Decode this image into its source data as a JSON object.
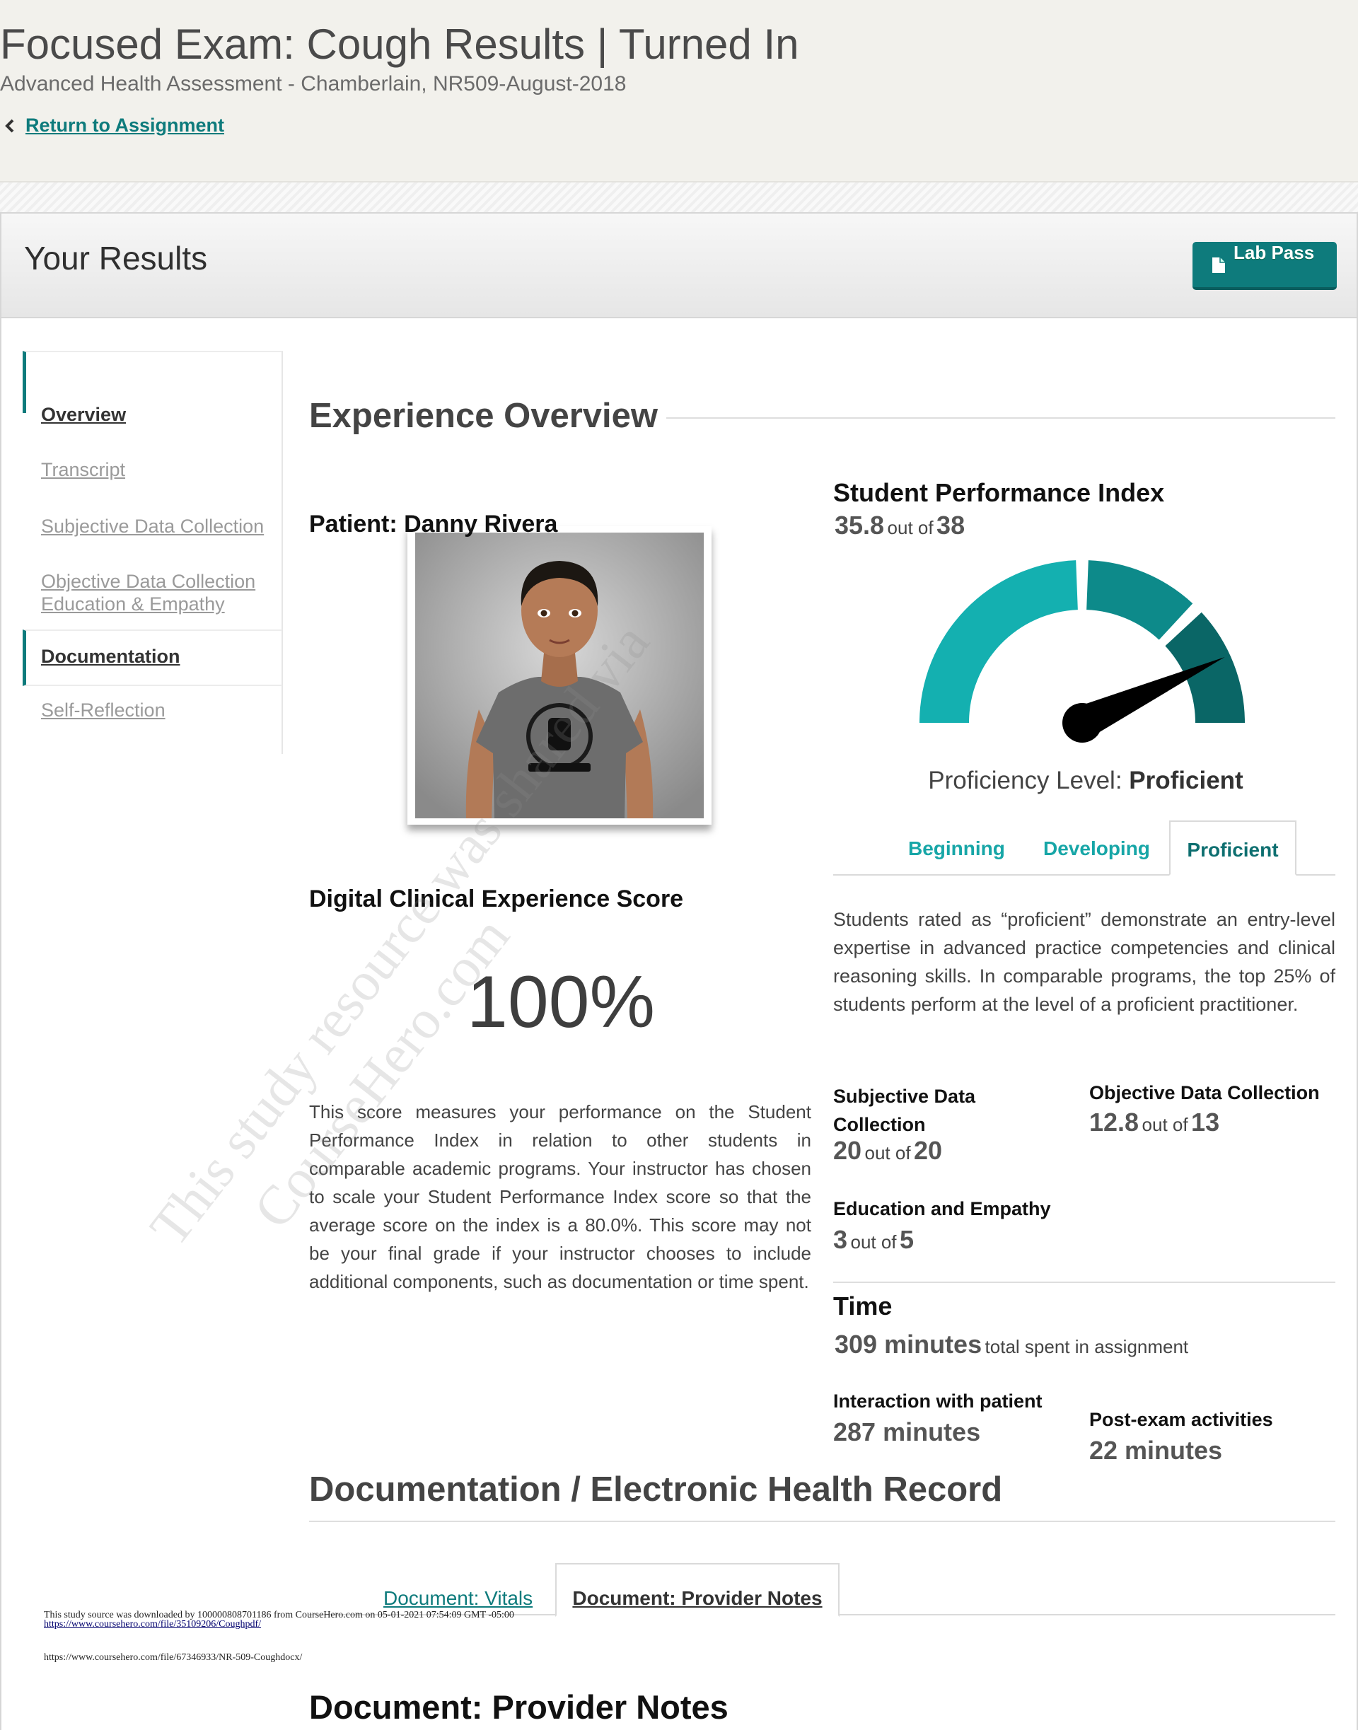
{
  "header": {
    "title": "Focused Exam: Cough Results | Turned In",
    "subtitle": "Advanced Health Assessment - Chamberlain, NR509-August-2018",
    "return_link": "Return to Assignment"
  },
  "panel": {
    "title": "Your Results",
    "lab_pass_label": "Lab Pass"
  },
  "sidebar": {
    "items": [
      {
        "label": "Overview"
      },
      {
        "label": "Transcript"
      },
      {
        "label": "Subjective Data Collection"
      },
      {
        "label": "Objective Data Collection"
      },
      {
        "label": "Education & Empathy"
      },
      {
        "label": "Documentation"
      },
      {
        "label": "Self-Reflection"
      }
    ]
  },
  "overview": {
    "section_title": "Experience Overview",
    "patient_label": "Patient: Danny Rivera",
    "dce_title": "Digital Clinical Experience Score",
    "dce_score": "100%",
    "dce_description": "This score measures your performance on the Student Performance Index in relation to other students in comparable academic programs. Your instructor has chosen to scale your Student Performance Index score so that the average score on the index is a 80.0%. This score may not be your final grade if your instructor chooses to include additional components, such as documentation or time spent."
  },
  "spi": {
    "title": "Student Performance Index",
    "score": "35.8",
    "out_of_text": "out of",
    "max": "38",
    "score_fraction": 0.942,
    "proficiency_prefix": "Proficiency Level:",
    "proficiency_value": "Proficient",
    "gauge_colors": [
      "#14b0b0",
      "#0d8a8a",
      "#0a6666"
    ],
    "tabs": [
      "Beginning",
      "Developing",
      "Proficient"
    ],
    "active_tab": "Proficient",
    "tab_description": "Students rated as “proficient” demonstrate an entry-level expertise in advanced practice competencies and clinical reasoning skills. In comparable  programs,  the top 25% of students perform at the level of a proficient practitioner."
  },
  "categories": {
    "subjective": {
      "label": "Subjective Data Collection",
      "score": "20",
      "max": "20"
    },
    "objective": {
      "label": "Objective Data Collection",
      "score": "12.8",
      "max": "13"
    },
    "education": {
      "label": "Education and Empathy",
      "score": "3",
      "max": "5"
    },
    "out_of_text": "out of"
  },
  "time": {
    "title": "Time",
    "total": "309 minutes",
    "total_suffix": "total spent in assignment",
    "interaction_label": "Interaction with patient",
    "interaction_value": "287 minutes",
    "post_label": "Post-exam activities",
    "post_value": "22 minutes"
  },
  "documentation": {
    "section_title": "Documentation / Electronic Health Record",
    "tabs": [
      "Document: Vitals",
      "Document: Provider Notes"
    ],
    "active_tab": "Document: Provider Notes",
    "doc_title": "Document: Provider Notes"
  },
  "footer": {
    "line1": "This study source was downloaded by 100000808701186 from CourseHero.com on 05-01-2021 07:54:09 GMT -05:00",
    "link": "https://www.coursehero.com/file/35109206/Coughpdf/",
    "line2": "https://www.coursehero.com/file/67346933/NR-509-Coughdocx/"
  },
  "watermark": {
    "line1": "This study resource was shared via",
    "line2": "CourseHero.com"
  }
}
